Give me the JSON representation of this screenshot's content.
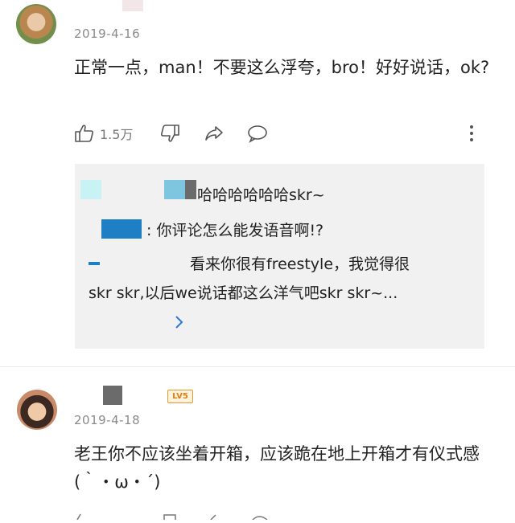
{
  "comments": [
    {
      "date": "2019-4-16",
      "text": "正常一点，man！不要这么浮夸，bro！好好说话，ok?",
      "like_count": "1.5万",
      "replies": [
        {
          "text": "哈哈哈哈哈哈skr~"
        },
        {
          "text": ": 你评论怎么能发语音啊!?"
        },
        {
          "text_line1": "看来你很有freestyle，我觉得很",
          "text_line2": "skr skr,以后we说话都这么洋气吧skr skr~..."
        }
      ],
      "icons": {
        "like": "thumb-up-icon",
        "dislike": "thumb-down-icon",
        "share": "share-icon",
        "reply": "comment-icon",
        "more": "more-vertical-icon",
        "expand": "chevron-right-icon"
      }
    },
    {
      "date": "2019-4-18",
      "level_badge": "LV5",
      "text": "老王你不应该坐着开箱，应该跪在地上开箱才有仪式感(｀・ω・´)"
    }
  ],
  "colors": {
    "text": "#222222",
    "secondary": "#8a8a8a",
    "reply_bg": "#f1f1f2",
    "link_blue": "#2b78d6",
    "badge_orange": "#e07d10"
  }
}
